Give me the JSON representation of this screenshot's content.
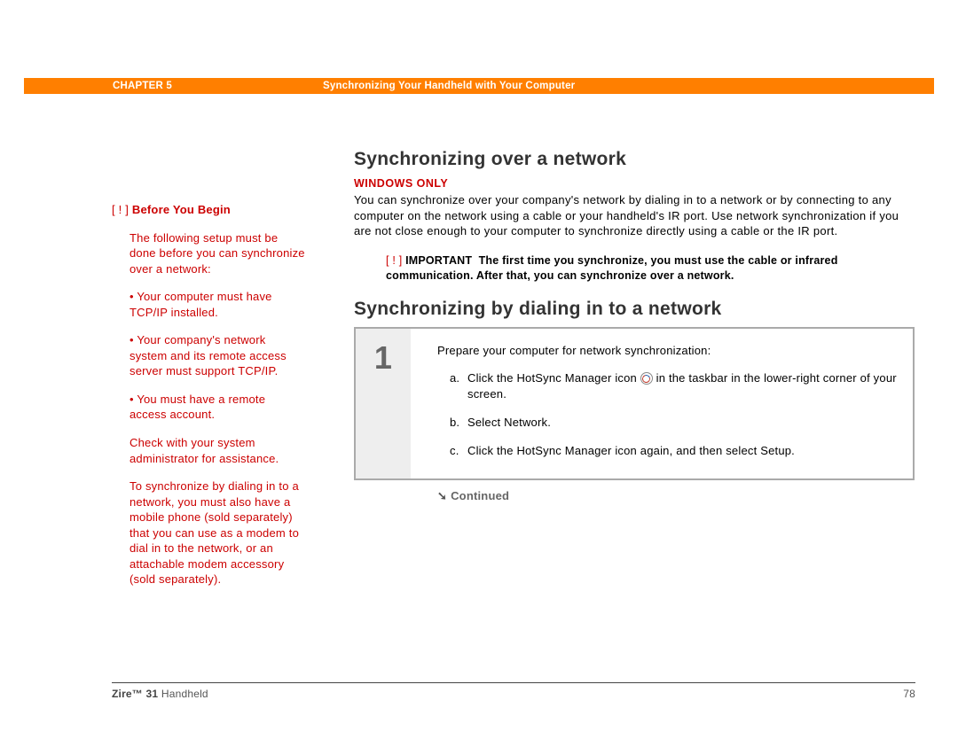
{
  "header": {
    "chapter": "CHAPTER 5",
    "title": "Synchronizing Your Handheld with Your Computer"
  },
  "sidebar": {
    "before_bracket": "[ ! ]",
    "before_label": "Before You Begin",
    "p1": "The following setup must be done before you can synchronize over a network:",
    "b1": "• Your computer must have TCP/IP installed.",
    "b2": "• Your company's network system and its remote access server must support TCP/IP.",
    "b3": "• You must have a remote access account.",
    "p2": "Check with your system administrator for assistance.",
    "p3": "To synchronize by dialing in to a network, you must also have a mobile phone (sold separately) that you can use as a modem to dial in to the network, or an attachable modem accessory (sold separately)."
  },
  "main": {
    "h1": "Synchronizing over a network",
    "windows_only": "WINDOWS ONLY",
    "body": "You can synchronize over your company's network by dialing in to a network or by connecting to any computer on the network using a cable or your handheld's IR port. Use network synchronization if you are not close enough to your computer to synchronize directly using a cable or the IR port.",
    "important_bracket": "[ ! ]",
    "important_label": "IMPORTANT",
    "important_text": "The first time you synchronize, you must use the cable or infrared communication. After that, you can synchronize over a network.",
    "h2": "Synchronizing by dialing in to a network",
    "step_num": "1",
    "step_intro": "Prepare your computer for network synchronization:",
    "step_a_label": "a.",
    "step_a_pre": "Click the HotSync Manager icon ",
    "step_a_post": " in the taskbar in the lower-right corner of your screen.",
    "step_b_label": "b.",
    "step_b": "Select Network.",
    "step_c_label": "c.",
    "step_c": "Click the HotSync Manager icon again, and then select Setup.",
    "continued": "Continued"
  },
  "footer": {
    "product_bold": "Zire™ 31",
    "product_rest": " Handheld",
    "page": "78"
  }
}
